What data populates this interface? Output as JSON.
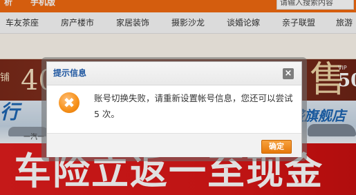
{
  "top_tabs": [
    "析",
    "手机版"
  ],
  "search": {
    "placeholder": "请输入搜索内容"
  },
  "nav": [
    "车友茶座",
    "房产楼市",
    "家居装饰",
    "摄影沙龙",
    "谈婚论嫁",
    "亲子联盟",
    "旅游"
  ],
  "ads": {
    "banner1": {
      "left_text": "铺",
      "big_text": "40",
      "right_glyph": "售",
      "vip": "VIP",
      "right_number": "50"
    },
    "banner2": {
      "left_text": "行",
      "left_sub": "一汽一",
      "right_text": "盛旗舰店"
    },
    "banner3": {
      "slogan": "车险立返一至现金"
    }
  },
  "dialog": {
    "title": "提示信息",
    "close_label": "×",
    "icon": "error-x-icon",
    "icon_glyph": "✖",
    "message": "账号切换失败，请重新设置帐号信息，您还可以尝试 5 次。",
    "ok_label": "确定"
  },
  "colors": {
    "brand_orange": "#f26a10",
    "title_blue": "#1e56a0",
    "ad_red": "#d91616"
  }
}
